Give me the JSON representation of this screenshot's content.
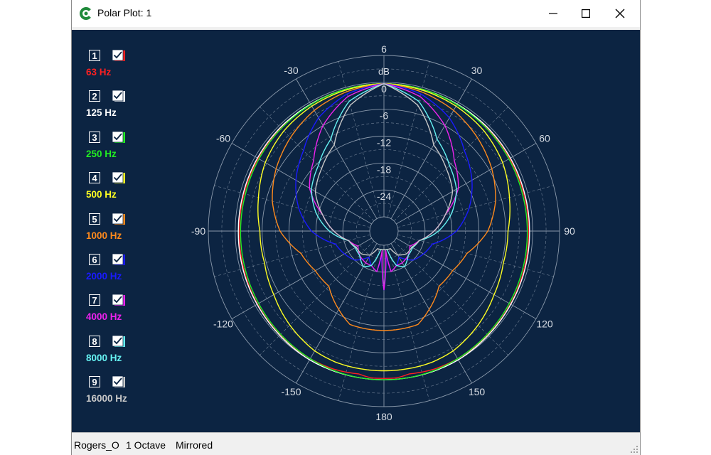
{
  "window": {
    "title": "Polar Plot: 1",
    "app_icon": "refresh-c-icon",
    "controls": [
      "minimize-icon",
      "maximize-icon",
      "close-icon"
    ]
  },
  "legend": {
    "items": [
      {
        "number": "1",
        "label": "63 Hz",
        "color": "#ff2020",
        "checked": true
      },
      {
        "number": "2",
        "label": "125 Hz",
        "color": "#ffffff",
        "checked": true
      },
      {
        "number": "3",
        "label": "250 Hz",
        "color": "#22ee22",
        "checked": true
      },
      {
        "number": "4",
        "label": "500 Hz",
        "color": "#ffff22",
        "checked": true
      },
      {
        "number": "5",
        "label": "1000 Hz",
        "color": "#ff8a1c",
        "checked": true
      },
      {
        "number": "6",
        "label": "2000 Hz",
        "color": "#1a1aff",
        "checked": true
      },
      {
        "number": "7",
        "label": "4000 Hz",
        "color": "#ee22ee",
        "checked": true
      },
      {
        "number": "8",
        "label": "8000 Hz",
        "color": "#66f2f2",
        "checked": true
      },
      {
        "number": "9",
        "label": "16000 Hz",
        "color": "#c8c8c8",
        "checked": true
      }
    ]
  },
  "status": {
    "name": "Rogers_O",
    "smoothing": "1 Octave",
    "mode": "Mirrored"
  },
  "chart_data": {
    "type": "polar",
    "radial_unit": "dB",
    "radial_ticks": [
      "6",
      "0",
      "-6",
      "-12",
      "-18",
      "-24"
    ],
    "radial_range": [
      -30,
      6
    ],
    "angle_labels": [
      "-30",
      "30",
      "-60",
      "60",
      "-90",
      "90",
      "-120",
      "120",
      "-150",
      "150",
      "180"
    ],
    "mirrored": true,
    "angles_deg": [
      0,
      15,
      30,
      45,
      60,
      75,
      90,
      105,
      120,
      135,
      150,
      160,
      170,
      175,
      180
    ],
    "series": [
      {
        "name": "63 Hz",
        "color": "#ff2020",
        "values": [
          -0.3,
          -0.4,
          -0.5,
          -0.6,
          -0.8,
          -0.9,
          -0.9,
          -0.8,
          -0.6,
          -0.4,
          -0.3,
          -0.4,
          -0.8,
          -0.3,
          -0.3
        ]
      },
      {
        "name": "125 Hz",
        "color": "#ffffff",
        "values": [
          -0.3,
          -0.4,
          -0.5,
          -0.5,
          -0.6,
          -0.7,
          -0.7,
          -0.6,
          -0.5,
          -0.3,
          0.0,
          0.0,
          0.0,
          0.0,
          0.0
        ]
      },
      {
        "name": "250 Hz",
        "color": "#22ee22",
        "values": [
          -0.3,
          -0.4,
          -0.6,
          -0.8,
          -1.0,
          -1.2,
          -1.2,
          -1.1,
          -0.9,
          -0.6,
          -0.3,
          -0.1,
          0.0,
          0.0,
          0.0
        ]
      },
      {
        "name": "500 Hz",
        "color": "#ffff22",
        "values": [
          -0.3,
          -0.6,
          -1.0,
          -1.6,
          -2.6,
          -4.2,
          -5.5,
          -5.6,
          -4.8,
          -3.5,
          -2.3,
          -2.0,
          -2.0,
          -2.0,
          -2.0
        ]
      },
      {
        "name": "1000 Hz",
        "color": "#ff8a1c",
        "values": [
          -0.3,
          -1.0,
          -2.1,
          -3.7,
          -5.4,
          -7.4,
          -10.0,
          -14.0,
          -15.5,
          -15.8,
          -13.0,
          -11.0,
          -11.0,
          -11.0,
          -11.0
        ]
      },
      {
        "name": "2000 Hz",
        "color": "#1a1aff",
        "values": [
          -0.3,
          -1.5,
          -4.0,
          -7.8,
          -10.5,
          -13.5,
          -17.0,
          -22.0,
          -23.0,
          -24.0,
          -26.5,
          -25.0,
          -24.0,
          -28.0,
          -20.0
        ]
      },
      {
        "name": "4000 Hz",
        "color": "#ee22ee",
        "values": [
          -0.3,
          -2.1,
          -6.0,
          -11.0,
          -14.0,
          -19.0,
          -22.0,
          -25.0,
          -26.5,
          -25.5,
          -25.0,
          -25.0,
          -24.0,
          -29.0,
          -20.0
        ]
      },
      {
        "name": "8000 Hz",
        "color": "#66f2f2",
        "values": [
          -0.3,
          -3.2,
          -9.5,
          -12.5,
          -14.5,
          -17.5,
          -21.0,
          -25.0,
          -25.8,
          -25.5,
          -24.0,
          -25.0,
          -29.0,
          -29.0,
          -29.0
        ]
      },
      {
        "name": "16000 Hz",
        "color": "#c8c8c8",
        "values": [
          -0.3,
          -4.1,
          -11.0,
          -13.5,
          -15.5,
          -19.0,
          -22.0,
          -25.0,
          -26.0,
          -26.0,
          -27.0,
          -29.0,
          -29.0,
          -29.0,
          -29.0
        ]
      }
    ]
  }
}
